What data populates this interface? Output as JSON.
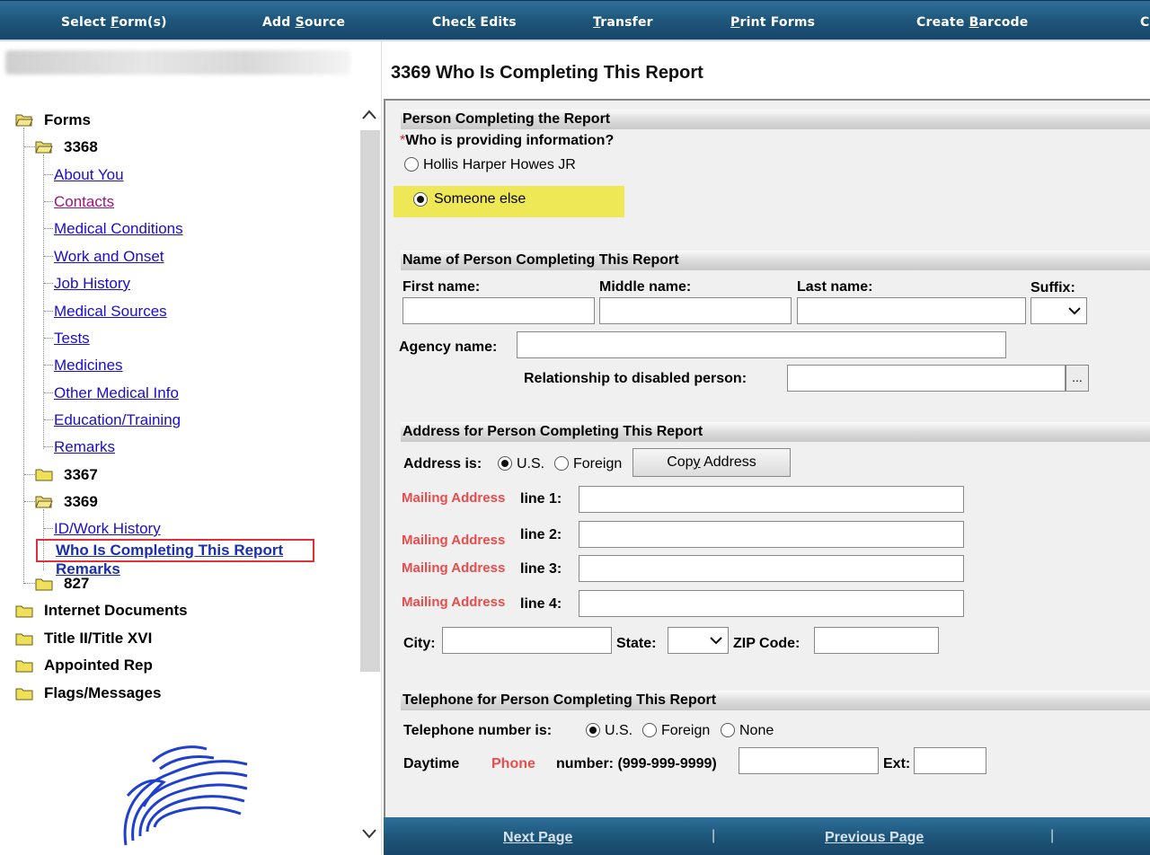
{
  "toolbar": {
    "items": [
      {
        "pre": "Select ",
        "u": "F",
        "post": "orm(s)"
      },
      {
        "pre": "Add ",
        "u": "S",
        "post": "ource"
      },
      {
        "pre": "Chec",
        "u": "k",
        "post": " Edits"
      },
      {
        "pre": "",
        "u": "T",
        "post": "ransfer"
      },
      {
        "pre": "",
        "u": "P",
        "post": "rint Forms"
      },
      {
        "pre": "Create ",
        "u": "B",
        "post": "arcode"
      },
      {
        "pre": "C",
        "u": "",
        "post": ""
      }
    ]
  },
  "page_title": "3369 Who Is Completing This Report",
  "tree": {
    "forms": "Forms",
    "f3368": "3368",
    "f3368_items": [
      "About You",
      "Contacts",
      "Medical Conditions",
      "Work and Onset",
      "Job History",
      "Medical Sources",
      "Tests",
      "Medicines",
      "Other Medical Info",
      "Education/Training",
      "Remarks"
    ],
    "f3367": "3367",
    "f3369": "3369",
    "f3369_items": [
      "ID/Work History",
      "Who Is Completing This Report",
      "Remarks"
    ],
    "f827": "827",
    "internet_docs": "Internet Documents",
    "title2": "Title II/Title XVI",
    "appointed_rep": "Appointed Rep",
    "flags": "Flags/Messages"
  },
  "person": {
    "header": "Person Completing the Report",
    "required_mark": "*",
    "question": "Who is providing information?",
    "option1": "Hollis Harper Howes JR",
    "option2": "Someone else"
  },
  "name_section": {
    "header": "Name of Person Completing This Report",
    "first": "First name:",
    "middle": "Middle name:",
    "last": "Last name:",
    "suffix": "Suffix:",
    "agency": "Agency name:",
    "relationship": "Relationship to disabled person:",
    "ellipsis": "..."
  },
  "address": {
    "header": "Address for Person Completing This Report",
    "is_label": "Address is:",
    "us": "U.S.",
    "foreign": "Foreign",
    "copy_pre": "Cop",
    "copy_u": "y",
    "copy_post": " Address",
    "mailing": "Mailing Address",
    "line1": "line 1:",
    "line2": "line 2:",
    "line3": "line 3:",
    "line4": "line 4:",
    "city": "City:",
    "state": "State:",
    "zip": "ZIP Code:"
  },
  "telephone": {
    "header": "Telephone for Person Completing This Report",
    "is_label": "Telephone number is:",
    "us": "U.S.",
    "foreign": "Foreign",
    "none": "None",
    "daytime": "Daytime",
    "phone": "Phone",
    "number": "number: (999-999-9999)",
    "ext": "Ext:"
  },
  "bottom": {
    "next_u": "N",
    "next_post": "ext Page",
    "prev_pre": "Pre",
    "prev_u": "v",
    "prev_post": "ious Page",
    "sep": "|"
  },
  "colors": {
    "toolbar": "#1d5478",
    "link": "#1a0dcc",
    "visited": "#a0137a",
    "mailing_red": "#e84c4c",
    "highlight": "#efe856",
    "selected_outline": "#e0303a"
  }
}
